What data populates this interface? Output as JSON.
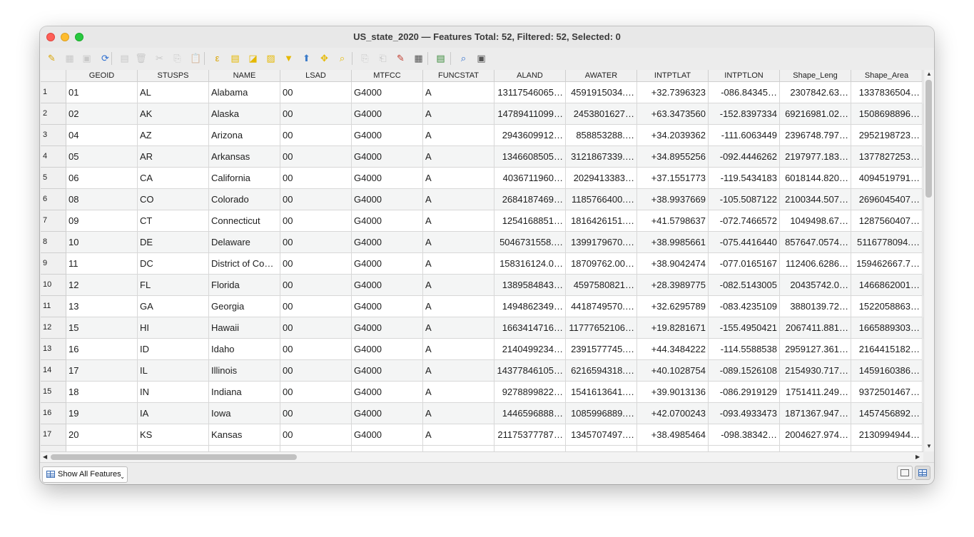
{
  "window": {
    "title": "US_state_2020 — Features Total: 52, Filtered: 52, Selected: 0"
  },
  "toolbar": {
    "buttons": [
      {
        "name": "toggle-editing-pencil-icon",
        "glyph": "✎",
        "enabled": true,
        "color": "#d9a300"
      },
      {
        "name": "multi-edit-icon",
        "glyph": "▦",
        "enabled": false,
        "color": "#888"
      },
      {
        "name": "save-edits-icon",
        "glyph": "▣",
        "enabled": false,
        "color": "#888"
      },
      {
        "name": "reload-icon",
        "glyph": "⟳",
        "enabled": true,
        "color": "#2f6fd0"
      },
      {
        "name": "add-feature-icon",
        "glyph": "▤",
        "enabled": false,
        "color": "#888"
      },
      {
        "name": "delete-feature-icon",
        "glyph": "🗑",
        "enabled": false,
        "color": "#888"
      },
      {
        "name": "cut-icon",
        "glyph": "✂",
        "enabled": false,
        "color": "#888"
      },
      {
        "name": "copy-icon",
        "glyph": "⎘",
        "enabled": false,
        "color": "#888"
      },
      {
        "name": "paste-icon",
        "glyph": "📋",
        "enabled": false,
        "color": "#888"
      },
      {
        "name": "select-by-expression-icon",
        "glyph": "ε",
        "enabled": true,
        "color": "#d9a300"
      },
      {
        "name": "select-all-icon",
        "glyph": "▤",
        "enabled": true,
        "color": "#e5b800"
      },
      {
        "name": "invert-selection-icon",
        "glyph": "◪",
        "enabled": true,
        "color": "#e5b800"
      },
      {
        "name": "deselect-all-icon",
        "glyph": "▨",
        "enabled": true,
        "color": "#e5b800"
      },
      {
        "name": "filter-icon",
        "glyph": "▼",
        "enabled": true,
        "color": "#e5b800"
      },
      {
        "name": "move-selection-to-top-icon",
        "glyph": "⬆",
        "enabled": true,
        "color": "#3d7cc9"
      },
      {
        "name": "pan-to-selection-icon",
        "glyph": "✥",
        "enabled": true,
        "color": "#e5b800"
      },
      {
        "name": "zoom-to-selection-icon",
        "glyph": "⌕",
        "enabled": true,
        "color": "#e5b800"
      },
      {
        "name": "copy-rows-icon",
        "glyph": "⎘",
        "enabled": false,
        "color": "#888"
      },
      {
        "name": "paste-rows-icon",
        "glyph": "⎗",
        "enabled": false,
        "color": "#888"
      },
      {
        "name": "delete-field-icon",
        "glyph": "✎",
        "enabled": true,
        "color": "#c0392b"
      },
      {
        "name": "field-calculator-icon",
        "glyph": "▦",
        "enabled": true,
        "color": "#555"
      },
      {
        "name": "conditional-formatting-icon",
        "glyph": "▤",
        "enabled": true,
        "color": "#3a8a3a"
      },
      {
        "name": "zoom-map-icon",
        "glyph": "⌕",
        "enabled": true,
        "color": "#2f6fd0"
      },
      {
        "name": "actions-icon",
        "glyph": "▣",
        "enabled": true,
        "color": "#555"
      }
    ]
  },
  "table": {
    "columns": [
      "GEOID",
      "STUSPS",
      "NAME",
      "LSAD",
      "MTFCC",
      "FUNCSTAT",
      "ALAND",
      "AWATER",
      "INTPTLAT",
      "INTPTLON",
      "Shape_Leng",
      "Shape_Area"
    ],
    "rows": [
      {
        "n": "1",
        "c": [
          "01",
          "AL",
          "Alabama",
          "00",
          "G4000",
          "A",
          "13117546065…",
          "4591915034.…",
          "+32.7396323",
          "-086.84345…",
          "2307842.63…",
          "1337836504…"
        ]
      },
      {
        "n": "2",
        "c": [
          "02",
          "AK",
          "Alaska",
          "00",
          "G4000",
          "A",
          "14789411099…",
          "2453801627…",
          "+63.3473560",
          "-152.8397334",
          "69216981.02…",
          "1508698896…"
        ]
      },
      {
        "n": "3",
        "c": [
          "04",
          "AZ",
          "Arizona",
          "00",
          "G4000",
          "A",
          "2943609912…",
          "858853288.…",
          "+34.2039362",
          "-111.6063449",
          "2396748.797…",
          "2952198723…"
        ]
      },
      {
        "n": "4",
        "c": [
          "05",
          "AR",
          "Arkansas",
          "00",
          "G4000",
          "A",
          "1346608505…",
          "3121867339.…",
          "+34.8955256",
          "-092.4446262",
          "2197977.183…",
          "1377827253…"
        ]
      },
      {
        "n": "5",
        "c": [
          "06",
          "CA",
          "California",
          "00",
          "G4000",
          "A",
          "4036711960…",
          "2029413383…",
          "+37.1551773",
          "-119.5434183",
          "6018144.820…",
          "4094519791…"
        ]
      },
      {
        "n": "6",
        "c": [
          "08",
          "CO",
          "Colorado",
          "00",
          "G4000",
          "A",
          "2684187469…",
          "1185766400.…",
          "+38.9937669",
          "-105.5087122",
          "2100344.507…",
          "2696045407…"
        ]
      },
      {
        "n": "7",
        "c": [
          "09",
          "CT",
          "Connecticut",
          "00",
          "G4000",
          "A",
          "1254168851…",
          "1816426151.…",
          "+41.5798637",
          "-072.7466572",
          "1049498.67…",
          "1287560407…"
        ]
      },
      {
        "n": "8",
        "c": [
          "10",
          "DE",
          "Delaware",
          "00",
          "G4000",
          "A",
          "5046731558.…",
          "1399179670.…",
          "+38.9985661",
          "-075.4416440",
          "857647.0574…",
          "5116778094.…"
        ]
      },
      {
        "n": "9",
        "c": [
          "11",
          "DC",
          "District of Co…",
          "00",
          "G4000",
          "A",
          "158316124.0…",
          "18709762.00…",
          "+38.9042474",
          "-077.0165167",
          "112406.6286…",
          "159462667.7…"
        ]
      },
      {
        "n": "10",
        "c": [
          "12",
          "FL",
          "Florida",
          "00",
          "G4000",
          "A",
          "1389584843…",
          "4597580821…",
          "+28.3989775",
          "-082.5143005",
          "20435742.0…",
          "1466862001…"
        ]
      },
      {
        "n": "11",
        "c": [
          "13",
          "GA",
          "Georgia",
          "00",
          "G4000",
          "A",
          "1494862349…",
          "4418749570.…",
          "+32.6295789",
          "-083.4235109",
          "3880139.72…",
          "1522058863…"
        ]
      },
      {
        "n": "12",
        "c": [
          "15",
          "HI",
          "Hawaii",
          "00",
          "G4000",
          "A",
          "1663414716…",
          "11777652106…",
          "+19.8281671",
          "-155.4950421",
          "2067411.881…",
          "1665889303…"
        ]
      },
      {
        "n": "13",
        "c": [
          "16",
          "ID",
          "Idaho",
          "00",
          "G4000",
          "A",
          "2140499234…",
          "2391577745.…",
          "+44.3484222",
          "-114.5588538",
          "2959127.361…",
          "2164415182…"
        ]
      },
      {
        "n": "14",
        "c": [
          "17",
          "IL",
          "Illinois",
          "00",
          "G4000",
          "A",
          "14377846105…",
          "6216594318.…",
          "+40.1028754",
          "-089.1526108",
          "2154930.717…",
          "1459160386…"
        ]
      },
      {
        "n": "15",
        "c": [
          "18",
          "IN",
          "Indiana",
          "00",
          "G4000",
          "A",
          "9278899822…",
          "1541613641.…",
          "+39.9013136",
          "-086.2919129",
          "1751411.249…",
          "9372501467…"
        ]
      },
      {
        "n": "16",
        "c": [
          "19",
          "IA",
          "Iowa",
          "00",
          "G4000",
          "A",
          "1446596888…",
          "1085996889.…",
          "+42.0700243",
          "-093.4933473",
          "1871367.947…",
          "1457456892…"
        ]
      },
      {
        "n": "17",
        "c": [
          "20",
          "KS",
          "Kansas",
          "00",
          "G4000",
          "A",
          "21175377787…",
          "1345707497.…",
          "+38.4985464",
          "-098.38342…",
          "2004627.974…",
          "2130994944…"
        ]
      }
    ]
  },
  "bottom": {
    "show_all_label": "Show All Features"
  }
}
